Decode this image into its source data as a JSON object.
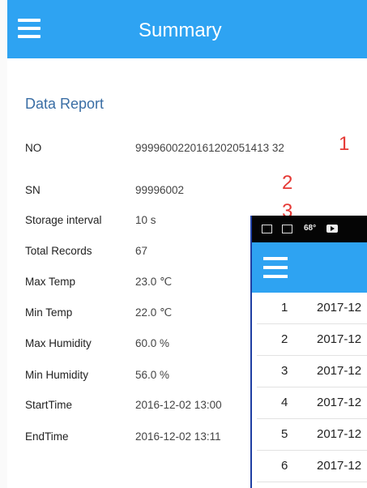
{
  "header": {
    "title": "Summary"
  },
  "report": {
    "title": "Data Report",
    "rows": [
      {
        "label": "NO",
        "value": "9999600220161202051413 32"
      },
      {
        "label": "SN",
        "value": "99996002"
      },
      {
        "label": "Storage interval",
        "value": "10 s"
      },
      {
        "label": "Total Records",
        "value": "67"
      },
      {
        "label": "Max Temp",
        "value": "23.0 ℃"
      },
      {
        "label": "Min Temp",
        "value": "22.0 ℃"
      },
      {
        "label": "Max Humidity",
        "value": "60.0 %"
      },
      {
        "label": "Min Humidity",
        "value": "56.0 %"
      },
      {
        "label": "StartTime",
        "value": "2016-12-02 13:00"
      },
      {
        "label": "EndTime",
        "value": "2016-12-02 13:11"
      }
    ]
  },
  "annotations": [
    "1",
    "2",
    "3"
  ],
  "overlay": {
    "status_text": "68°",
    "rows": [
      {
        "num": "1",
        "date": "2017-12"
      },
      {
        "num": "2",
        "date": "2017-12"
      },
      {
        "num": "3",
        "date": "2017-12"
      },
      {
        "num": "4",
        "date": "2017-12"
      },
      {
        "num": "5",
        "date": "2017-12"
      },
      {
        "num": "6",
        "date": "2017-12"
      }
    ]
  },
  "colors": {
    "accent": "#2ea3f2",
    "annotation": "#e53935",
    "overlay_border": "#1f3fa3"
  }
}
